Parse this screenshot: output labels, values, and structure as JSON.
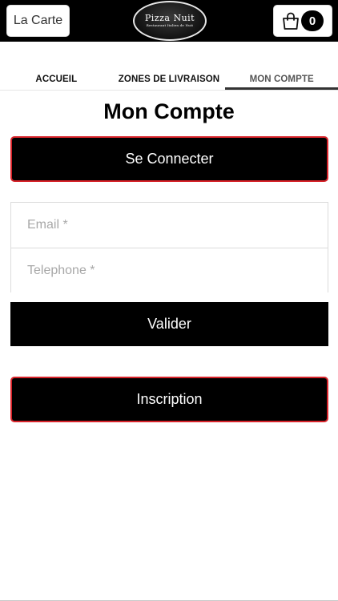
{
  "header": {
    "carte_label": "La Carte",
    "logo_title": "Pizza Nuit",
    "logo_subtitle": "Restaurant Italien de Nuit",
    "cart_count": "0"
  },
  "nav": {
    "tabs": [
      {
        "label": "ACCUEIL",
        "active": false
      },
      {
        "label": "ZONES DE LIVRAISON",
        "active": false
      },
      {
        "label": "MON COMPTE",
        "active": true
      }
    ]
  },
  "page_title": "Mon Compte",
  "connect_label": "Se Connecter",
  "form": {
    "email_placeholder": "Email *",
    "email_value": "",
    "phone_placeholder": "Telephone *",
    "phone_value": ""
  },
  "valider_label": "Valider",
  "inscription_label": "Inscription",
  "colors": {
    "header_bg": "#000000",
    "button_bg": "#000000",
    "accent_border": "#d8232a"
  }
}
